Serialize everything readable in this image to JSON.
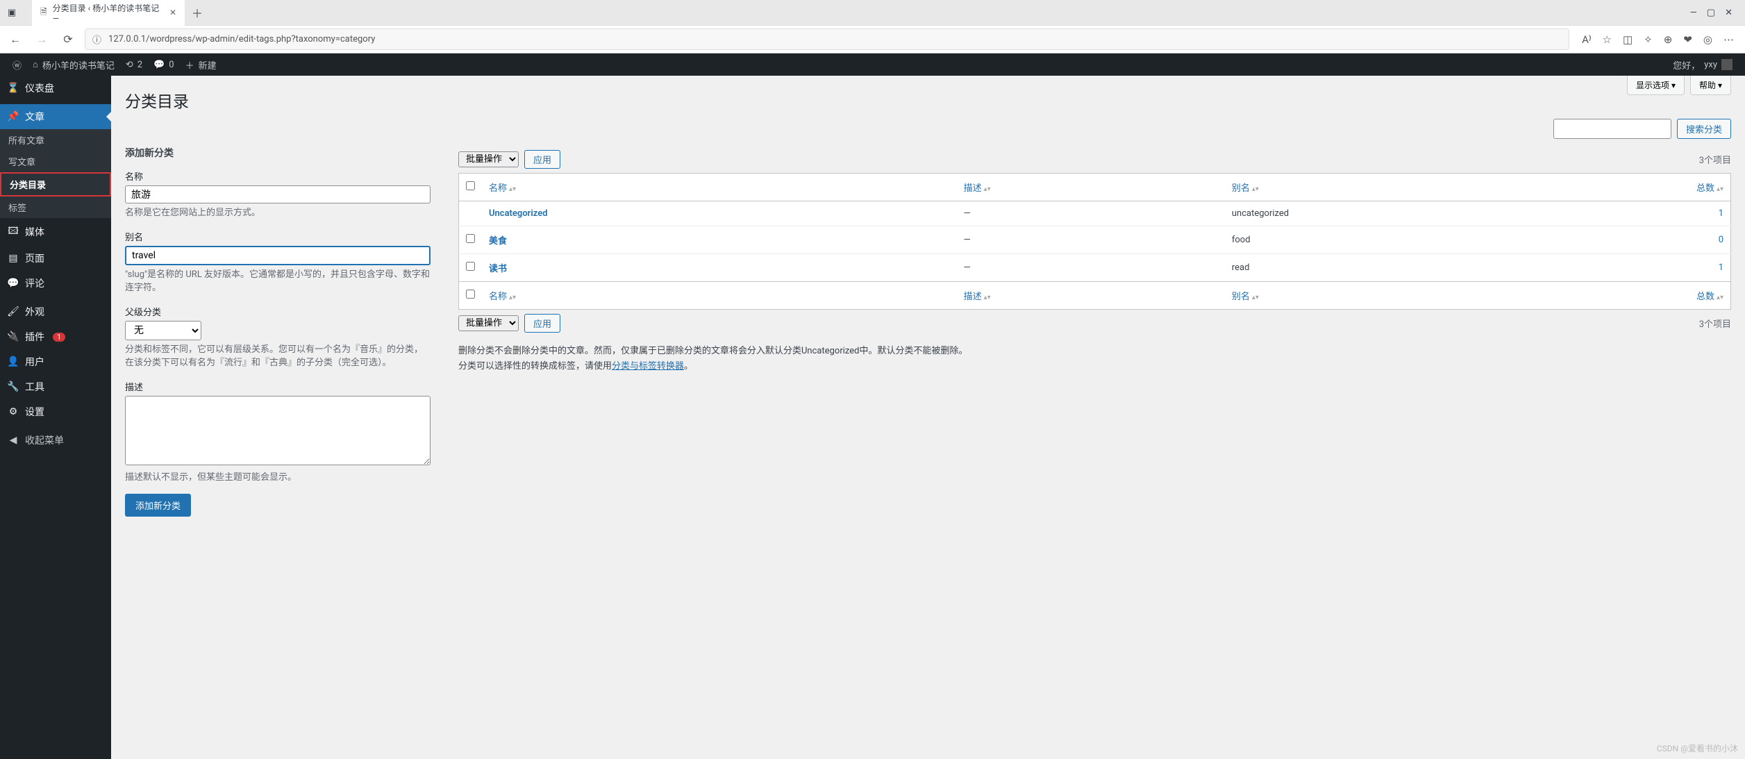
{
  "browser": {
    "tab_title": "分类目录 ‹ 杨小羊的读书笔记 —",
    "url": "127.0.0.1/wordpress/wp-admin/edit-tags.php?taxonomy=category",
    "window_controls": {
      "min": "—",
      "max": "▢",
      "close": "✕"
    }
  },
  "adminbar": {
    "site_name": "杨小羊的读书笔记",
    "updates": "2",
    "comments": "0",
    "new_label": "新建",
    "greeting": "您好，",
    "user": "yxy"
  },
  "sidebar": {
    "dashboard": "仪表盘",
    "posts": "文章",
    "posts_sub": {
      "all": "所有文章",
      "new": "写文章",
      "categories": "分类目录",
      "tags": "标签"
    },
    "media": "媒体",
    "pages": "页面",
    "comments": "评论",
    "appearance": "外观",
    "plugins": "插件",
    "plugins_badge": "1",
    "users": "用户",
    "tools": "工具",
    "settings": "设置",
    "collapse": "收起菜单"
  },
  "screen_meta": {
    "options": "显示选项 ▾",
    "help": "帮助 ▾"
  },
  "page": {
    "title": "分类目录",
    "add_heading": "添加新分类",
    "name_label": "名称",
    "name_value": "旅游",
    "name_desc": "名称是它在您网站上的显示方式。",
    "slug_label": "别名",
    "slug_value": "travel",
    "slug_desc": "\"slug\"是名称的 URL 友好版本。它通常都是小写的，并且只包含字母、数字和连字符。",
    "parent_label": "父级分类",
    "parent_value": "无",
    "parent_desc": "分类和标签不同，它可以有层级关系。您可以有一个名为『音乐』的分类，在该分类下可以有名为『流行』和『古典』的子分类（完全可选）。",
    "desc_label": "描述",
    "desc_desc": "描述默认不显示，但某些主题可能会显示。",
    "submit": "添加新分类"
  },
  "list": {
    "search_button": "搜索分类",
    "bulk_label": "批量操作",
    "apply": "应用",
    "items_count": "3个项目",
    "cols": {
      "name": "名称",
      "desc": "描述",
      "slug": "别名",
      "posts": "总数"
    },
    "rows": [
      {
        "name": "Uncategorized",
        "desc": "—",
        "slug": "uncategorized",
        "posts": "1"
      },
      {
        "name": "美食",
        "desc": "—",
        "slug": "food",
        "posts": "0"
      },
      {
        "name": "读书",
        "desc": "—",
        "slug": "read",
        "posts": "1"
      }
    ],
    "note1_a": "删除分类不会删除分类中的文章。然而，仅隶属于已删除分类的文章将会分入默认分类Uncategorized中。默认分类不能被删除。",
    "note2_a": "分类可以选择性的转换成标签，请使用",
    "note2_link": "分类与标签转换器",
    "note2_b": "。"
  },
  "watermark": "CSDN @爱看书的小沐"
}
